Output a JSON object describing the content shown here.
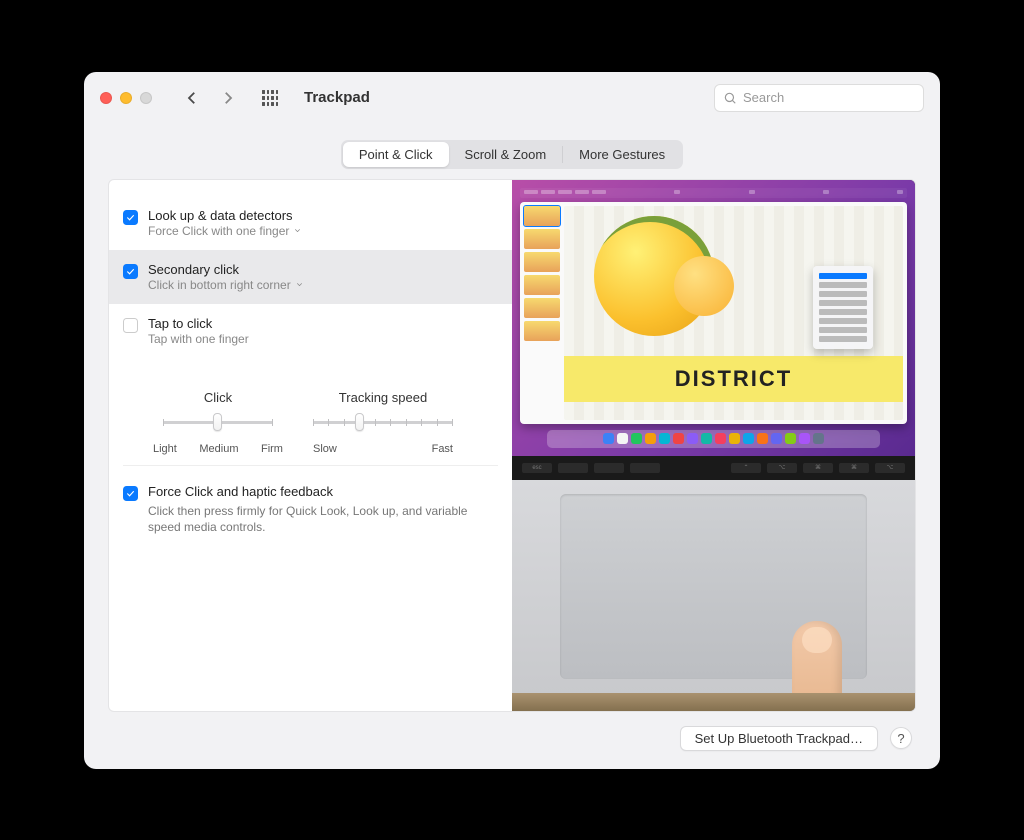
{
  "window": {
    "title": "Trackpad"
  },
  "search": {
    "placeholder": "Search"
  },
  "tabs": {
    "point_click": "Point & Click",
    "scroll_zoom": "Scroll & Zoom",
    "more_gestures": "More Gestures",
    "active": "point_click"
  },
  "options": {
    "lookup": {
      "title": "Look up & data detectors",
      "sub": "Force Click with one finger",
      "checked": true
    },
    "secondary": {
      "title": "Secondary click",
      "sub": "Click in bottom right corner",
      "checked": true,
      "selected": true
    },
    "tap": {
      "title": "Tap to click",
      "sub": "Tap with one finger",
      "checked": false
    }
  },
  "sliders": {
    "click": {
      "label": "Click",
      "min": "Light",
      "mid": "Medium",
      "max": "Firm",
      "value_index": 1,
      "steps": 3
    },
    "tracking": {
      "label": "Tracking speed",
      "min": "Slow",
      "max": "Fast",
      "value_index": 3,
      "steps": 10
    }
  },
  "force_click": {
    "title": "Force Click and haptic feedback",
    "desc": "Click then press firmly for Quick Look, Look up, and variable speed media controls.",
    "checked": true
  },
  "preview": {
    "banner_text": "DISTRICT"
  },
  "footer": {
    "setup": "Set Up Bluetooth Trackpad…",
    "help": "?"
  }
}
